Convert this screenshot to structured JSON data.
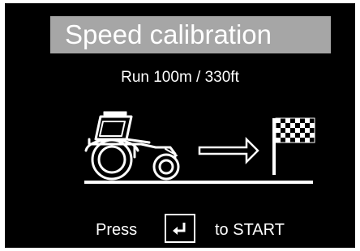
{
  "title": "Speed calibration",
  "instruction": "Run 100m / 330ft",
  "footer": {
    "press_label": "Press",
    "key_icon": "enter-key-icon",
    "start_label": "to START"
  },
  "illustration": {
    "vehicle_icon": "tractor-icon",
    "direction_icon": "right-arrow-icon",
    "goal_icon": "checkered-flag-icon"
  },
  "colors": {
    "screen_bg": "#000000",
    "title_bar": "#a6a6a6",
    "foreground": "#ffffff"
  }
}
